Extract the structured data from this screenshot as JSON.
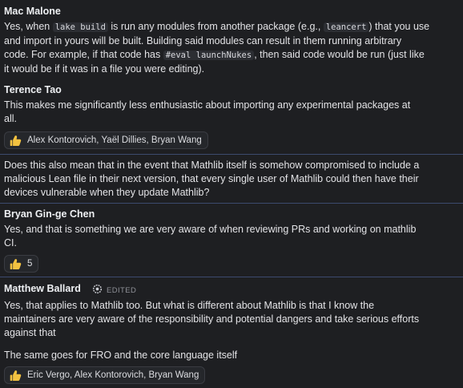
{
  "messages": [
    {
      "author": "Mac Malone",
      "para1": {
        "t1": "Yes, when ",
        "c1": "lake build",
        "t2": " is run any modules from another package (e.g., ",
        "c2": "leancert",
        "t3": ") that you use",
        "line2": "and import in yours will be built. Building said modules can result in them running arbitrary",
        "t4": "code. For example, if that code has ",
        "c3": "#eval launchNukes",
        "t5": ", then said code would be run (just like",
        "line4": "it would be if it was in a file you were editing)."
      }
    },
    {
      "author": "Terence Tao",
      "line1": "This makes me significantly less enthusiastic about importing any experimental packages at",
      "line2": "all.",
      "reaction": "Alex Kontorovich, Yaël Dillies, Bryan Wang"
    },
    {
      "line1": "Does this also mean that in the event that Mathlib itself is somehow compromised to include a",
      "line2": "malicious Lean file in their next version, that every single user of Mathlib could then have their",
      "line3": "devices vulnerable when they update Mathlib?"
    },
    {
      "author": "Bryan Gin-ge Chen",
      "line1": "Yes, and that is something we are very aware of when reviewing PRs and working on mathlib",
      "line2": "CI.",
      "reaction": "5"
    },
    {
      "author": "Matthew Ballard",
      "edited": "EDITED",
      "line1": "Yes, that applies to Mathlib too. But what is different about Mathlib is that I know the",
      "line2": "maintainers are very aware of the responsibility and potential dangers and take serious efforts",
      "line3": "against that",
      "line4": "The same goes for FRO and the core language itself",
      "reaction": "Eric Vergo, Alex Kontorovich, Bryan Wang"
    }
  ],
  "icons": {
    "reaction": "thumbs-up-icon",
    "edited": "edit-history-icon"
  },
  "colors": {
    "background": "#1e1f22",
    "divider": "#3c4a6e",
    "thumb": "#f3c240"
  }
}
